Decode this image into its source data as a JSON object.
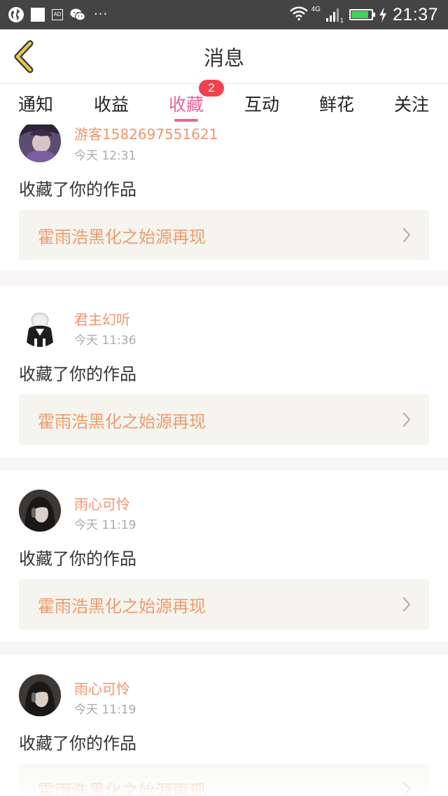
{
  "status_bar": {
    "time": "21:37",
    "network": "4G",
    "sim": "1",
    "battery_level": 0.85,
    "battery_color": "#3fd25a",
    "icons": [
      "globe-icon",
      "notification-square-icon",
      "ad-icon",
      "wechat-icon",
      "more-icon",
      "wifi-icon",
      "signal-icon",
      "battery-icon",
      "charging-icon"
    ],
    "more": "···"
  },
  "header": {
    "title": "消息",
    "back_icon": "chevron-left-icon"
  },
  "tabs": [
    {
      "label": "通知",
      "active": false
    },
    {
      "label": "收益",
      "active": false
    },
    {
      "label": "收藏",
      "active": true,
      "badge": "2"
    },
    {
      "label": "互动",
      "active": false
    },
    {
      "label": "鲜花",
      "active": false
    },
    {
      "label": "关注",
      "active": false
    }
  ],
  "colors": {
    "accent": "#e8649a",
    "badge": "#f0414d",
    "username": "#f0956a",
    "work_title": "#ee9c6c",
    "card_link_bg": "#f5f4ef"
  },
  "messages": [
    {
      "username": "游客1582697551621",
      "time": "今天 12:31",
      "action": "收藏了你的作品",
      "work": "霍雨浩黑化之始源再现"
    },
    {
      "username": "君主幻听",
      "time": "今天 11:36",
      "action": "收藏了你的作品",
      "work": "霍雨浩黑化之始源再现"
    },
    {
      "username": "雨心可怜",
      "time": "今天 11:19",
      "action": "收藏了你的作品",
      "work": "霍雨浩黑化之始源再现"
    },
    {
      "username": "雨心可怜",
      "time": "今天 11:19",
      "action": "收藏了你的作品",
      "work": "霍雨浩黑化之始源再现"
    }
  ]
}
